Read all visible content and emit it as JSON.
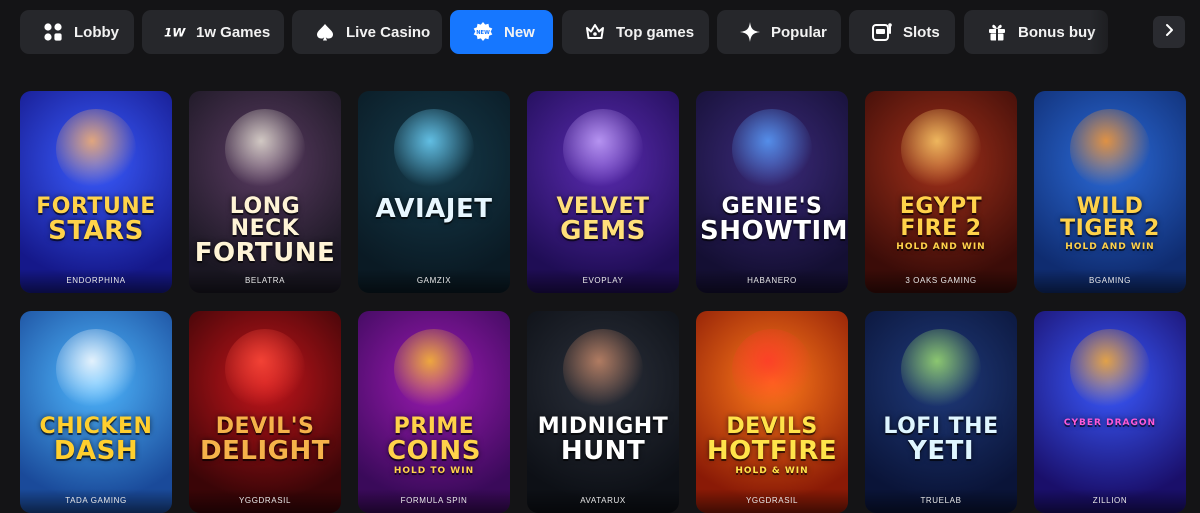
{
  "tabs": [
    {
      "label": "Lobby",
      "icon": "grid-icon",
      "active": false
    },
    {
      "label": "1w Games",
      "icon": "1w-logo-icon",
      "active": false
    },
    {
      "label": "Live Casino",
      "icon": "spade-icon",
      "active": false
    },
    {
      "label": "New",
      "icon": "new-badge-icon",
      "active": true
    },
    {
      "label": "Top games",
      "icon": "crown-icon",
      "active": false
    },
    {
      "label": "Popular",
      "icon": "sparkle-icon",
      "active": false
    },
    {
      "label": "Slots",
      "icon": "slot-machine-icon",
      "active": false
    },
    {
      "label": "Bonus buy",
      "icon": "gift-icon",
      "active": false
    }
  ],
  "icon_texts": {
    "onew": "1W",
    "new_badge": "NEW"
  },
  "nav": {
    "next_icon": "chevron-right-icon"
  },
  "games": [
    {
      "title_l1": "Fortune",
      "title_l2": "Stars",
      "sub": "",
      "provider": "Endorphina",
      "bg": [
        "#3a5cff",
        "#15188a"
      ],
      "title_color": "#ffd34a",
      "accent": "#ffb56b"
    },
    {
      "title_l1": "Long Neck",
      "title_l2": "Fortune",
      "sub": "",
      "provider": "Belatra",
      "bg": [
        "#5a3b62",
        "#1a1722"
      ],
      "title_color": "#fff4d6",
      "accent": "#e8e2d6"
    },
    {
      "title_l1": "",
      "title_l2": "Aviajet",
      "sub": "",
      "provider": "Gamzix",
      "bg": [
        "#153a4a",
        "#0a1a24"
      ],
      "title_color": "#e8f7ff",
      "accent": "#6fd6ff"
    },
    {
      "title_l1": "Velvet",
      "title_l2": "Gems",
      "sub": "",
      "provider": "Evoplay",
      "bg": [
        "#5a2bb0",
        "#1f0d55"
      ],
      "title_color": "#ffe07a",
      "accent": "#c7a6ff"
    },
    {
      "title_l1": "Genie's",
      "title_l2": "Showtime",
      "sub": "",
      "provider": "Habanero",
      "bg": [
        "#3b2a7a",
        "#140f33"
      ],
      "title_color": "#ffffff",
      "accent": "#5aa0ff"
    },
    {
      "title_l1": "Egypt Fire 2",
      "title_l2": "",
      "sub": "Hold and Win",
      "provider": "3 Oaks Gaming",
      "bg": [
        "#a0301a",
        "#3b0c08"
      ],
      "title_color": "#ffd24a",
      "accent": "#ffcf6a"
    },
    {
      "title_l1": "Wild Tiger 2",
      "title_l2": "",
      "sub": "Hold and Win",
      "provider": "BGaming",
      "bg": [
        "#2b6ad8",
        "#0f2c70"
      ],
      "title_color": "#ffd24a",
      "accent": "#ff9a2e"
    },
    {
      "title_l1": "Chicken",
      "title_l2": "Dash",
      "sub": "",
      "provider": "TaDa Gaming",
      "bg": [
        "#4fb8ff",
        "#1a4a9a"
      ],
      "title_color": "#ffcf2e",
      "accent": "#ffffff"
    },
    {
      "title_l1": "Devil's",
      "title_l2": "Delight",
      "sub": "",
      "provider": "Yggdrasil",
      "bg": [
        "#c3151b",
        "#3a0507"
      ],
      "title_color": "#f5b24a",
      "accent": "#ff4a3a"
    },
    {
      "title_l1": "Prime",
      "title_l2": "Coins",
      "sub": "Hold to Win",
      "provider": "Formula Spin",
      "bg": [
        "#9a1ab0",
        "#3a0a5a"
      ],
      "title_color": "#ffd24a",
      "accent": "#ffc02e"
    },
    {
      "title_l1": "Midnight",
      "title_l2": "Hunt",
      "sub": "",
      "provider": "AvatarUX",
      "bg": [
        "#2a2f3a",
        "#0d1016"
      ],
      "title_color": "#ffffff",
      "accent": "#c98a6a"
    },
    {
      "title_l1": "Devils",
      "title_l2": "Hotfire",
      "sub": "Hold & Win",
      "provider": "Yggdrasil",
      "bg": [
        "#ff7a1a",
        "#8a1a06"
      ],
      "title_color": "#ffe34a",
      "accent": "#ff3a2a"
    },
    {
      "title_l1": "Lofi the",
      "title_l2": "Yeti",
      "sub": "",
      "provider": "TrueLab",
      "bg": [
        "#1f3a7a",
        "#0a1438"
      ],
      "title_color": "#dff6ff",
      "accent": "#9fe070"
    },
    {
      "title_l1": "",
      "title_l2": "",
      "sub": "Cyber Dragon",
      "provider": "Zillion",
      "bg": [
        "#3a5aff",
        "#1a0f6a"
      ],
      "title_color": "#ff5ad8",
      "accent": "#ffb02e"
    }
  ]
}
